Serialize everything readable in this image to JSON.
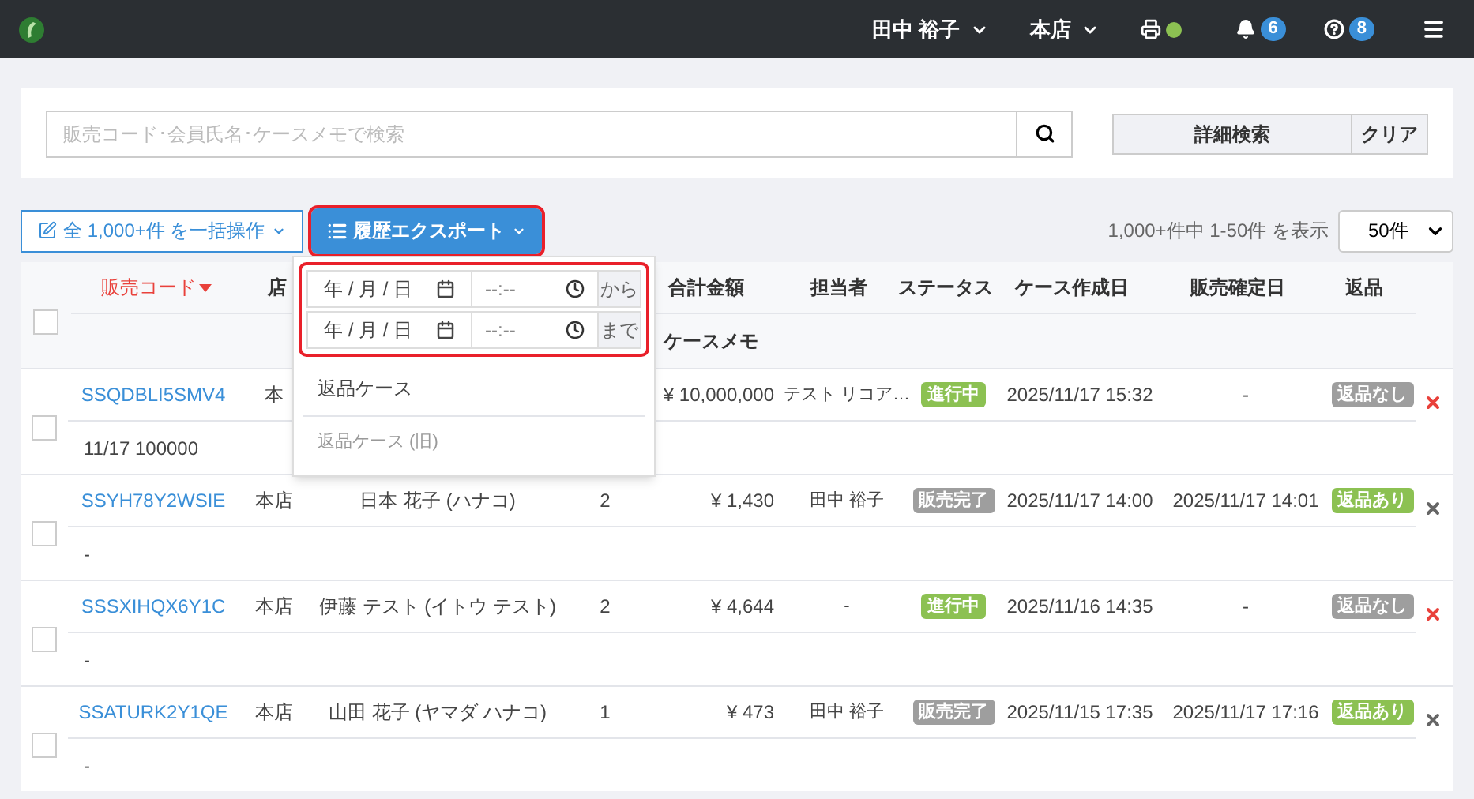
{
  "navbar": {
    "user": "田中 裕子",
    "store": "本店",
    "printer_online": true,
    "notifications": "6",
    "help": "8"
  },
  "search": {
    "placeholder": "販売コード･会員氏名･ケースメモで検索",
    "buttons": [
      "詳細検索",
      "クリア"
    ]
  },
  "toolbar": {
    "bulk": "全 1,000+件 を一括操作",
    "export": "履歴エクスポート",
    "paging": "1,000+件中 1-50件 を表示",
    "page_size": "50件"
  },
  "export_menu": {
    "ranges": [
      {
        "date": "年 / 月 / 日",
        "time": "--:--",
        "label": "から"
      },
      {
        "date": "年 / 月 / 日",
        "time": "--:--",
        "label": "まで"
      }
    ],
    "items": [
      {
        "label": "返品ケース",
        "disabled": false
      },
      {
        "label": "返品ケース (旧)",
        "disabled": true
      }
    ]
  },
  "table": {
    "columns": [
      {
        "label": "販売コード",
        "sorted": true
      },
      {
        "label": "店"
      },
      {
        "label": "合計金額"
      },
      {
        "label": "担当者"
      },
      {
        "label": "ステータス"
      },
      {
        "label": "ケース作成日"
      },
      {
        "label": "販売確定日"
      },
      {
        "label": "返品"
      }
    ],
    "memo_column": "ケースメモ",
    "select_all_checked": false,
    "rows": [
      {
        "code": "SSQDBLI5SMV4",
        "store": "本",
        "amount": "¥ 10,000,000",
        "staff": "テスト リコア…",
        "status": {
          "label": "進行中",
          "kind": "active"
        },
        "created": "2025/11/17 15:32",
        "confirmed": "-",
        "return": {
          "label": "返品なし",
          "kind": "none"
        },
        "deletable": true,
        "memo": "11/17 100000",
        "checked": false
      },
      {
        "code": "SSYH78Y2WSIE",
        "store": "本店",
        "customer": "日本 花子 (ハナコ)",
        "qty": "2",
        "amount": "¥ 1,430",
        "staff": "田中 裕子",
        "status": {
          "label": "販売完了",
          "kind": "done"
        },
        "created": "2025/11/17 14:00",
        "confirmed": "2025/11/17 14:01",
        "return": {
          "label": "返品あり",
          "kind": "returned"
        },
        "deletable": false,
        "memo": "-",
        "checked": false
      },
      {
        "code": "SSSXIHQX6Y1C",
        "store": "本店",
        "customer": "伊藤 テスト (イトウ テスト)",
        "qty": "2",
        "amount": "¥ 4,644",
        "staff": "-",
        "status": {
          "label": "進行中",
          "kind": "active"
        },
        "created": "2025/11/16 14:35",
        "confirmed": "-",
        "return": {
          "label": "返品なし",
          "kind": "none"
        },
        "deletable": true,
        "memo": "-",
        "checked": false
      },
      {
        "code": "SSATURK2Y1QE",
        "store": "本店",
        "customer": "山田 花子 (ヤマダ ハナコ)",
        "qty": "1",
        "amount": "¥ 473",
        "staff": "田中 裕子",
        "status": {
          "label": "販売完了",
          "kind": "done"
        },
        "created": "2025/11/15 17:35",
        "confirmed": "2025/11/17 17:16",
        "return": {
          "label": "返品あり",
          "kind": "returned"
        },
        "deletable": false,
        "memo": "-",
        "checked": false
      }
    ]
  }
}
